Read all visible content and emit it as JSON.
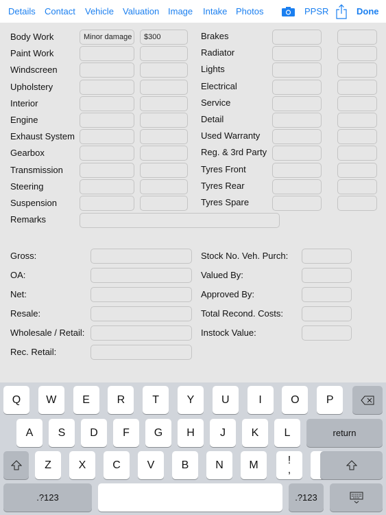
{
  "nav": {
    "tabs": [
      "Details",
      "Contact",
      "Vehicle",
      "Valuation",
      "Image",
      "Intake",
      "Photos"
    ],
    "camera_icon": "camera-icon",
    "ppsr": "PPSR",
    "share_icon": "share-icon",
    "done": "Done",
    "accent": "#1a7ff0"
  },
  "condition_left": [
    {
      "label": "Body Work",
      "desc": "Minor damage",
      "cost": "$300"
    },
    {
      "label": "Paint Work",
      "desc": "",
      "cost": ""
    },
    {
      "label": "Windscreen",
      "desc": "",
      "cost": ""
    },
    {
      "label": "Upholstery",
      "desc": "",
      "cost": ""
    },
    {
      "label": "Interior",
      "desc": "",
      "cost": ""
    },
    {
      "label": "Engine",
      "desc": "",
      "cost": ""
    },
    {
      "label": "Exhaust System",
      "desc": "",
      "cost": ""
    },
    {
      "label": "Gearbox",
      "desc": "",
      "cost": ""
    },
    {
      "label": "Transmission",
      "desc": "",
      "cost": ""
    },
    {
      "label": "Steering",
      "desc": "",
      "cost": ""
    },
    {
      "label": "Suspension",
      "desc": "",
      "cost": ""
    }
  ],
  "condition_right": [
    {
      "label": "Brakes"
    },
    {
      "label": "Radiator"
    },
    {
      "label": "Lights"
    },
    {
      "label": "Electrical"
    },
    {
      "label": "Service"
    },
    {
      "label": "Detail"
    },
    {
      "label": "Used Warranty"
    },
    {
      "label": "Reg. & 3rd Party"
    },
    {
      "label": "Tyres Front"
    },
    {
      "label": "Tyres Rear"
    },
    {
      "label": "Tyres Spare"
    }
  ],
  "remarks": {
    "label": "Remarks",
    "value": ""
  },
  "valuation_left": [
    {
      "label": "Gross:"
    },
    {
      "label": "OA:"
    },
    {
      "label": "Net:"
    },
    {
      "label": "Resale:"
    },
    {
      "label": "Wholesale / Retail:"
    },
    {
      "label": "Rec. Retail:"
    }
  ],
  "valuation_right": [
    {
      "label": "Stock No. Veh. Purch:"
    },
    {
      "label": "Valued By:"
    },
    {
      "label": "Approved By:"
    },
    {
      "label": "Total Recond. Costs:"
    },
    {
      "label": "Instock Value:"
    }
  ],
  "keyboard": {
    "row1": [
      "Q",
      "W",
      "E",
      "R",
      "T",
      "Y",
      "U",
      "I",
      "O",
      "P"
    ],
    "row2": [
      "A",
      "S",
      "D",
      "F",
      "G",
      "H",
      "J",
      "K",
      "L"
    ],
    "row3": [
      "Z",
      "X",
      "C",
      "V",
      "B",
      "N",
      "M"
    ],
    "punct": [
      [
        "!",
        ","
      ],
      [
        "?",
        "."
      ]
    ],
    "return": "return",
    "numbers": ".?123",
    "backspace_icon": "backspace-icon",
    "shift_icon": "shift-icon",
    "hide_icon": "keyboard-hide-icon"
  }
}
